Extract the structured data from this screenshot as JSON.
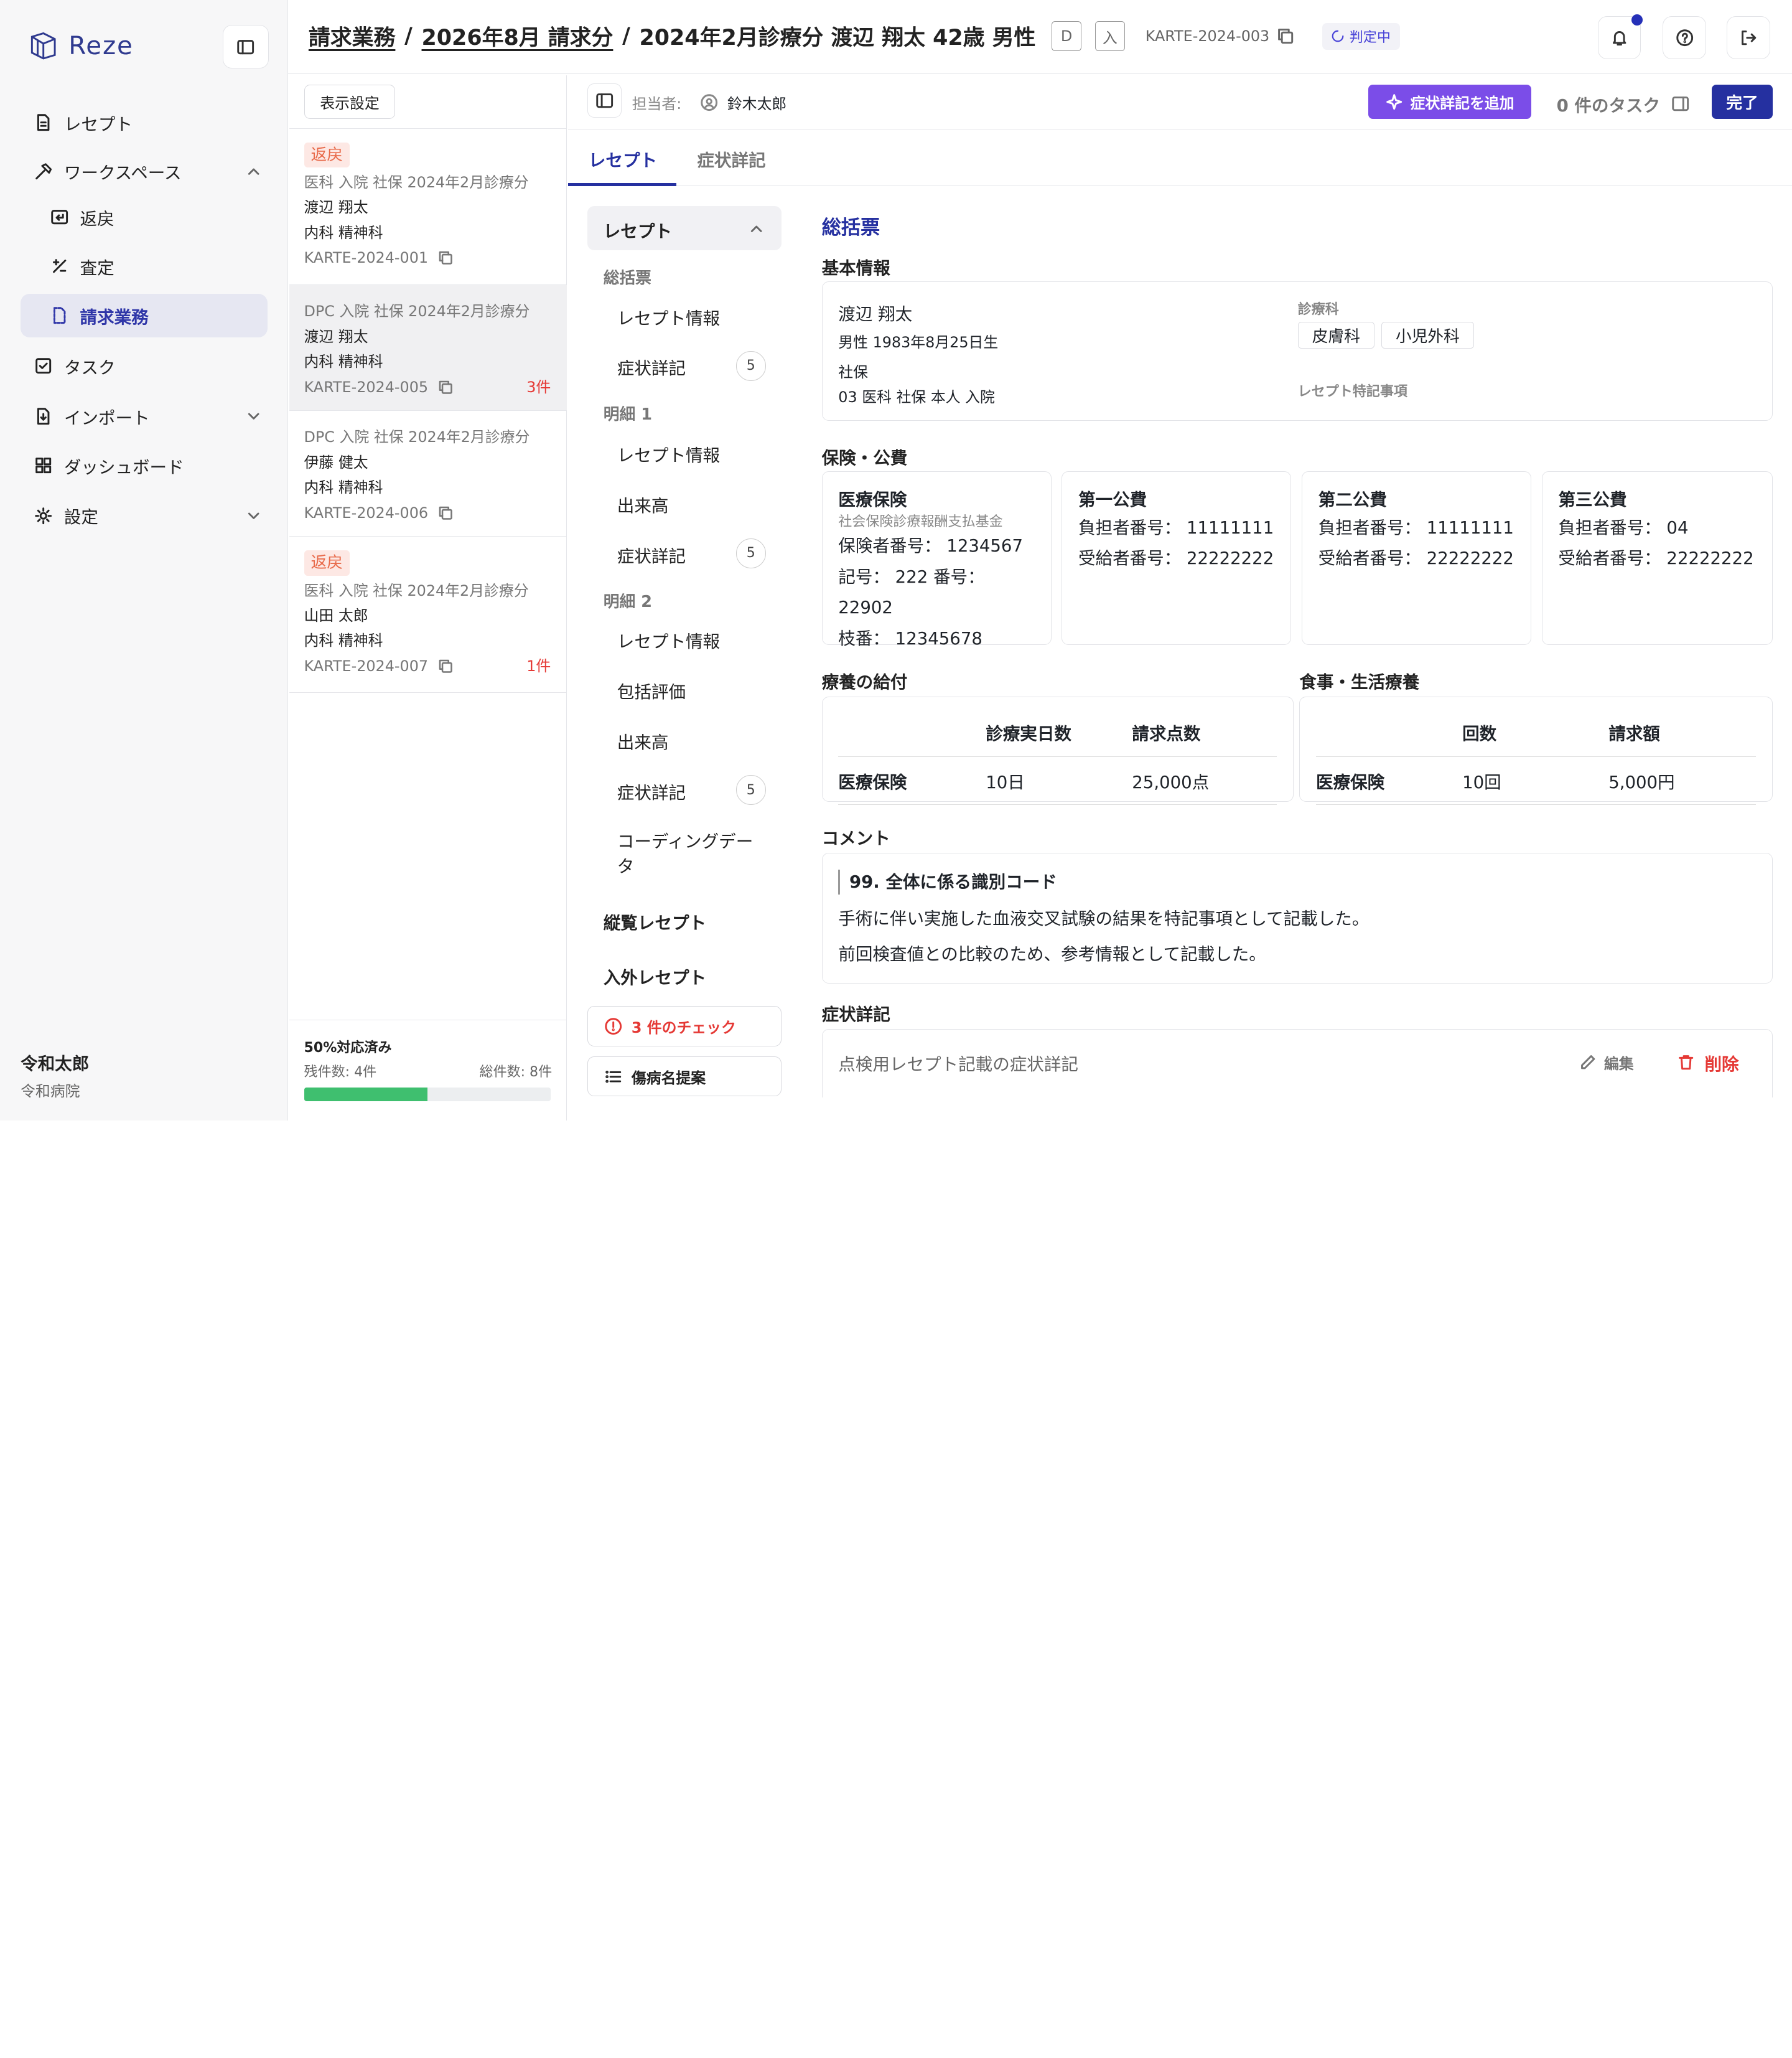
{
  "app": {
    "name": "Reze"
  },
  "sidebar": {
    "items": [
      {
        "label": "レセプト"
      },
      {
        "label": "ワークスペース"
      },
      {
        "label": "返戻"
      },
      {
        "label": "査定"
      },
      {
        "label": "請求業務"
      },
      {
        "label": "タスク"
      },
      {
        "label": "インポート"
      },
      {
        "label": "ダッシュボード"
      },
      {
        "label": "設定"
      }
    ],
    "user": {
      "name": "令和太郎",
      "hospital": "令和病院"
    }
  },
  "header": {
    "crumb1": "請求業務",
    "crumb2": "2026年8月 請求分",
    "patient": "2024年2月診療分  渡辺 翔太  42歳  男性",
    "badge1": "D",
    "badge2": "入",
    "karte": "KARTE-2024-003",
    "status": "判定中"
  },
  "list": {
    "display_settings": "表示設定",
    "cards": [
      {
        "badge": "返戻",
        "meta": "医科 入院 社保 2024年2月診療分",
        "name": "渡辺 翔太",
        "dept": "内科 精神科",
        "id": "KARTE-2024-001",
        "count": ""
      },
      {
        "badge": "",
        "meta": "DPC 入院 社保 2024年2月診療分",
        "name": "渡辺 翔太",
        "dept": "内科 精神科",
        "id": "KARTE-2024-005",
        "count": "3件"
      },
      {
        "badge": "",
        "meta": "DPC 入院 社保 2024年2月診療分",
        "name": "伊藤 健太",
        "dept": "内科 精神科",
        "id": "KARTE-2024-006",
        "count": ""
      },
      {
        "badge": "返戻",
        "meta": "医科 入院 社保 2024年2月診療分",
        "name": "山田 太郎",
        "dept": "内科 精神科",
        "id": "KARTE-2024-007",
        "count": "1件"
      }
    ],
    "progress": {
      "title": "50%対応済み",
      "remaining": "残件数: 4件",
      "total": "総件数: 8件",
      "fraction": 0.5
    }
  },
  "toolbar": {
    "assignee_label": "担当者:",
    "assignee": "鈴木太郎",
    "add_symptom": "症状詳記を追加",
    "tasks": "0 件のタスク",
    "done": "完了"
  },
  "tabs": [
    "レセプト",
    "症状詳記"
  ],
  "secnav": {
    "head": "レセプト",
    "g1": "総括票",
    "g1_i1": "レセプト情報",
    "g1_i2": "症状詳記",
    "g1_n2": "5",
    "g2": "明細 1",
    "g2_i1": "レセプト情報",
    "g2_i2": "出来高",
    "g2_i3": "症状詳記",
    "g2_n3": "5",
    "g3": "明細 2",
    "g3_i1": "レセプト情報",
    "g3_i2": "包括評価",
    "g3_i3": "出来高",
    "g3_i4": "症状詳記",
    "g3_n4": "5",
    "g3_i5": "コーディングデータ",
    "b1": "縦覧レセプト",
    "b2": "入外レセプト",
    "check": "3 件のチェック",
    "suggest": "傷病名提案"
  },
  "content": {
    "title": "総括票",
    "basic": {
      "h": "基本情報",
      "name": "渡辺 翔太",
      "dob": "男性 1983年8月25日生",
      "ins_l": "社保",
      "ins": "03 医科 社保 本人 入院",
      "dept_l": "診療科",
      "depts": [
        "皮膚科",
        "小児外科"
      ],
      "special_l": "レセプト特記事項"
    },
    "insurance": {
      "h": "保険・公費",
      "boxes": [
        {
          "title": "医療保険",
          "sub": "社会保険診療報酬支払基金",
          "l1": "保険者番号： 1234567",
          "l2": "記号： 222   番号： 22902",
          "l3": "枝番： 12345678"
        },
        {
          "title": "第一公費",
          "l1": "負担者番号： 11111111",
          "l2": "受給者番号： 22222222"
        },
        {
          "title": "第二公費",
          "l1": "負担者番号： 11111111",
          "l2": "受給者番号： 22222222"
        },
        {
          "title": "第三公費",
          "l1": "負担者番号： 04",
          "l2": "受給者番号： 22222222"
        }
      ]
    },
    "benefit": {
      "h": "療養の給付",
      "c1": "診療実日数",
      "c2": "請求点数",
      "row": "医療保険",
      "v1": "10日",
      "v2": "25,000点"
    },
    "meal": {
      "h": "食事・生活療養",
      "c1": "回数",
      "c2": "請求額",
      "row": "医療保険",
      "v1": "10回",
      "v2": "5,000円"
    },
    "comment": {
      "h": "コメント",
      "code": "99.  全体に係る識別コード",
      "l1": "手術に伴い実施した血液交叉試験の結果を特記事項として記載した。",
      "l2": "前回検査値との比較のため、参考情報として記載した。"
    },
    "symptom": {
      "h": "症状詳記",
      "placeholder": "点検用レセプト記載の症状詳記",
      "edit": "編集",
      "delete": "削除"
    }
  }
}
